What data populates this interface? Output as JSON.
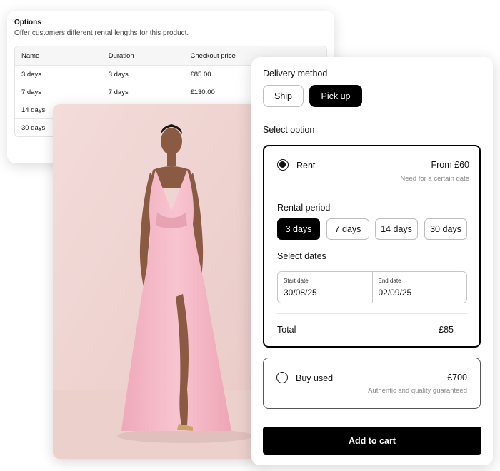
{
  "options": {
    "title": "Options",
    "description": "Offer customers different rental lengths for this product.",
    "headers": [
      "Name",
      "Duration",
      "Checkout price"
    ],
    "rows": [
      [
        "3 days",
        "3 days",
        "£85.00"
      ],
      [
        "7 days",
        "7 days",
        "£130.00"
      ],
      [
        "14 days",
        "",
        ""
      ],
      [
        "30 days",
        "",
        ""
      ]
    ]
  },
  "panel": {
    "delivery_label": "Delivery method",
    "delivery_options": [
      "Ship",
      "Pick up"
    ],
    "select_option_label": "Select option",
    "rent": {
      "name": "Rent",
      "price": "From £60",
      "subtitle": "Need for a certain date",
      "period_label": "Rental period",
      "periods": [
        "3 days",
        "7 days",
        "14 days",
        "30 days"
      ],
      "dates_label": "Select dates",
      "start_label": "Start date",
      "start_value": "30/08/25",
      "end_label": "End date",
      "end_value": "02/09/25",
      "total_label": "Total",
      "total_value": "£85"
    },
    "buy": {
      "name": "Buy used",
      "price": "£700",
      "subtitle": "Authentic and quality guaranteed"
    },
    "add_to_cart": "Add to cart"
  },
  "colors": {
    "accent": "#000000",
    "image_background": "#efd3d1",
    "dress": "#f6bcc9"
  }
}
